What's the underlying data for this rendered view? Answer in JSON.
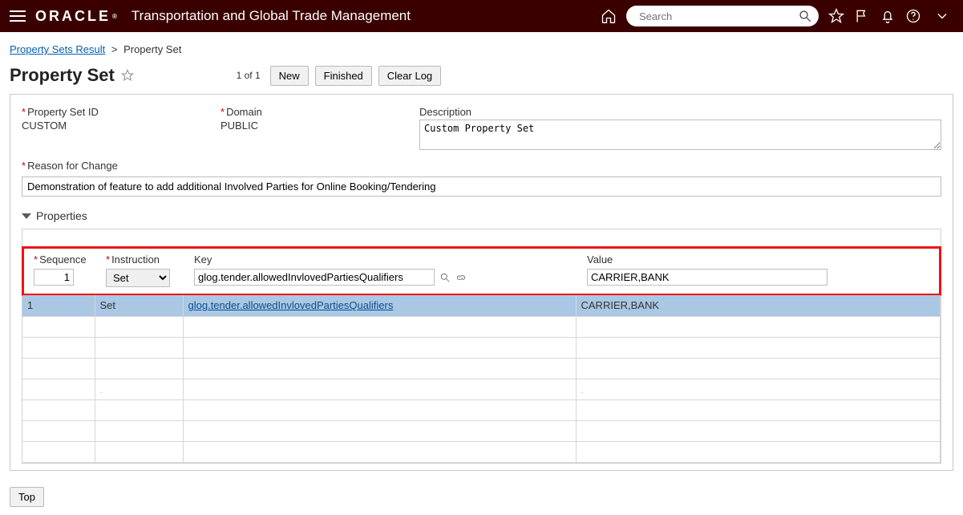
{
  "header": {
    "brand": "ORACLE",
    "app_title": "Transportation and Global Trade Management",
    "search_placeholder": "Search"
  },
  "breadcrumb": {
    "parent": "Property Sets Result",
    "current": "Property Set"
  },
  "page": {
    "title": "Property Set",
    "count_text": "1 of 1",
    "buttons": {
      "new": "New",
      "finished": "Finished",
      "clear_log": "Clear Log"
    }
  },
  "form": {
    "property_set_id": {
      "label": "Property Set ID",
      "value": "CUSTOM"
    },
    "domain": {
      "label": "Domain",
      "value": "PUBLIC"
    },
    "description": {
      "label": "Description",
      "value": "Custom Property Set"
    },
    "reason": {
      "label": "Reason for Change",
      "value": "Demonstration of feature to add additional Involved Parties for Online Booking/Tendering"
    }
  },
  "properties": {
    "section_title": "Properties",
    "columns": {
      "sequence": "Sequence",
      "instruction": "Instruction",
      "key": "Key",
      "value": "Value"
    },
    "filter": {
      "sequence": "1",
      "instruction_selected": "Set",
      "instruction_options": [
        "Set"
      ],
      "key": "glog.tender.allowedInvlovedPartiesQualifiers",
      "value": "CARRIER,BANK"
    },
    "rows": [
      {
        "sequence": "1",
        "instruction": "Set",
        "key": "glog.tender.allowedInvlovedPartiesQualifiers",
        "value": "CARRIER,BANK",
        "selected": true
      }
    ],
    "empty_row_count": 7
  },
  "footer": {
    "top": "Top"
  }
}
